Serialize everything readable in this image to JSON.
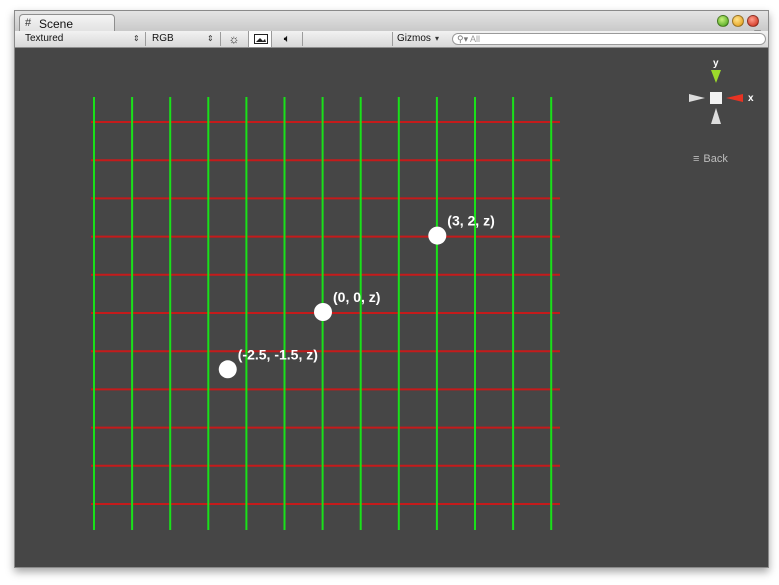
{
  "window": {
    "tab_label": "Scene",
    "tab_icon": "grid-icon"
  },
  "toolbar": {
    "render_mode": "Textured",
    "color_mode": "RGB",
    "gizmos_label": "Gizmos",
    "search_placeholder": "All",
    "lighting_icon": "sun-icon",
    "image_icon": "image-icon",
    "audio_icon": "speaker-icon"
  },
  "gizmo": {
    "y_label": "y",
    "x_label": "x",
    "view_label": "Back",
    "colors": {
      "y": "#9cd92b",
      "x": "#e83323",
      "neutral": "#dddddd"
    }
  },
  "scene": {
    "grid_colors": {
      "vertical": "#19e119",
      "horizontal": "#c51b1b"
    },
    "points": [
      {
        "label": "(3, 2, z)",
        "x": 3,
        "y": 2
      },
      {
        "label": "(0, 0, z)",
        "x": 0,
        "y": 0
      },
      {
        "label": "(-2.5, -1.5, z)",
        "x": -2.5,
        "y": -1.5
      }
    ]
  }
}
